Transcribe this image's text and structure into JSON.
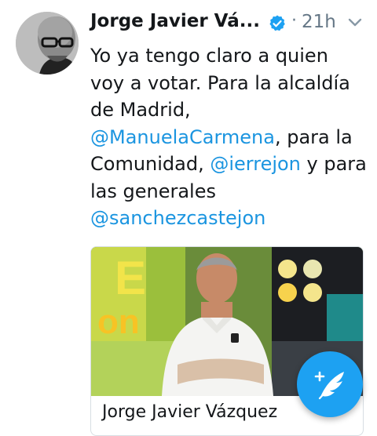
{
  "tweet": {
    "author": {
      "display_name": "Jorge Javier Vá...",
      "avatar_icon": "profile-photo-bald-man-glasses",
      "verified_icon": "verified-badge-icon"
    },
    "separator": "·",
    "timestamp": "21h",
    "text": {
      "line1": "Yo ya tengo claro a quien",
      "line2": "voy a votar. Para la alcaldía",
      "line3": "de Madrid,",
      "mention1": "@ManuelaCarmena",
      "line4_after": ", para la",
      "line5_before": "Comunidad, ",
      "mention2": "@ierrejon",
      "line5_after": " y para",
      "line6": "las generales",
      "mention3": "@sanchezcastejon"
    },
    "card": {
      "title": "Jorge Javier Vázquez"
    }
  },
  "compose_button": {
    "icon": "compose-feather-icon"
  },
  "colors": {
    "link": "#1b95e0",
    "verified": "#1da1f2",
    "fab": "#1da1f2",
    "meta": "#657786"
  }
}
